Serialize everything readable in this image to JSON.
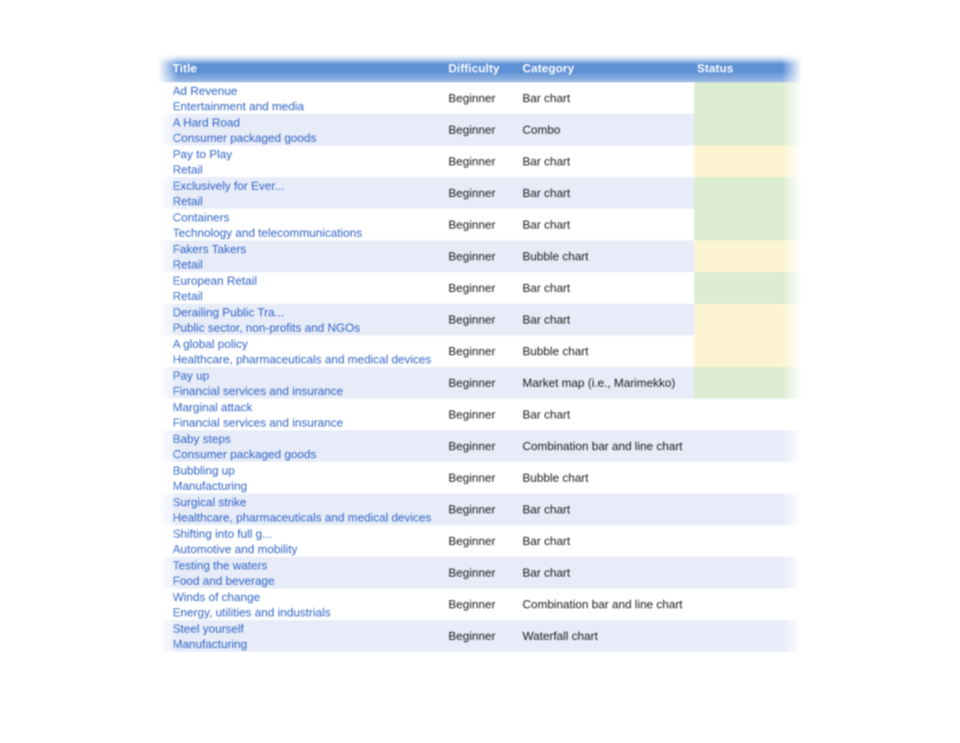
{
  "table": {
    "columns": [
      {
        "key": "title",
        "label": "Title"
      },
      {
        "key": "difficulty",
        "label": "Difficulty"
      },
      {
        "key": "category",
        "label": "Category"
      },
      {
        "key": "status",
        "label": "Status"
      }
    ],
    "colors": {
      "header_gradient_top": "#b9d1ef",
      "header_gradient_mid": "#5e90d6",
      "header_text": "#ffffff",
      "link_text": "#2f62c4",
      "body_text": "#1a1a1a",
      "row_even_bg": "#e7ecf8",
      "row_odd_bg": "#ffffff",
      "status_green": "#dcecd0",
      "status_yellow": "#fcf4d1"
    },
    "rows": [
      {
        "title": "Ad Revenue",
        "sector": "Entertainment and media",
        "difficulty": "Beginner",
        "category": "Bar chart",
        "status": "green"
      },
      {
        "title": "A Hard Road",
        "sector": "Consumer packaged goods",
        "difficulty": "Beginner",
        "category": "Combo",
        "status": "green"
      },
      {
        "title": "Pay to Play",
        "sector": "Retail",
        "difficulty": "Beginner",
        "category": "Bar chart",
        "status": "yellow"
      },
      {
        "title": "Exclusively for Ever...",
        "sector": "Retail",
        "difficulty": "Beginner",
        "category": "Bar chart",
        "status": "green"
      },
      {
        "title": "Containers",
        "sector": "Technology and telecommunications",
        "difficulty": "Beginner",
        "category": "Bar chart",
        "status": "green"
      },
      {
        "title": "Fakers Takers",
        "sector": "Retail",
        "difficulty": "Beginner",
        "category": "Bubble chart",
        "status": "yellow"
      },
      {
        "title": "European Retail",
        "sector": "Retail",
        "difficulty": "Beginner",
        "category": "Bar chart",
        "status": "green"
      },
      {
        "title": "Derailing Public Tra...",
        "sector": "Public sector, non-profits and NGOs",
        "difficulty": "Beginner",
        "category": "Bar chart",
        "status": "yellow"
      },
      {
        "title": "A global policy",
        "sector": "Healthcare, pharmaceuticals and medical devices",
        "difficulty": "Beginner",
        "category": "Bubble chart",
        "status": "yellow"
      },
      {
        "title": "Pay up",
        "sector": "Financial services and insurance",
        "difficulty": "Beginner",
        "category": "Market map (i.e., Marimekko)",
        "status": "green"
      },
      {
        "title": "Marginal attack",
        "sector": "Financial services and insurance",
        "difficulty": "Beginner",
        "category": "Bar chart",
        "status": "none"
      },
      {
        "title": "Baby steps",
        "sector": "Consumer packaged goods",
        "difficulty": "Beginner",
        "category": "Combination bar and line chart",
        "status": "none"
      },
      {
        "title": "Bubbling up",
        "sector": "Manufacturing",
        "difficulty": "Beginner",
        "category": "Bubble chart",
        "status": "none"
      },
      {
        "title": "Surgical strike",
        "sector": "Healthcare, pharmaceuticals and medical devices",
        "difficulty": "Beginner",
        "category": "Bar chart",
        "status": "none"
      },
      {
        "title": "Shifting into full g...",
        "sector": "Automotive and mobility",
        "difficulty": "Beginner",
        "category": "Bar chart",
        "status": "none"
      },
      {
        "title": "Testing the waters",
        "sector": "Food and beverage",
        "difficulty": "Beginner",
        "category": "Bar chart",
        "status": "none"
      },
      {
        "title": "Winds of change",
        "sector": "Energy, utilities and industrials",
        "difficulty": "Beginner",
        "category": "Combination bar and line chart",
        "status": "none"
      },
      {
        "title": "Steel yourself",
        "sector": "Manufacturing",
        "difficulty": "Beginner",
        "category": "Waterfall chart",
        "status": "none"
      }
    ]
  }
}
